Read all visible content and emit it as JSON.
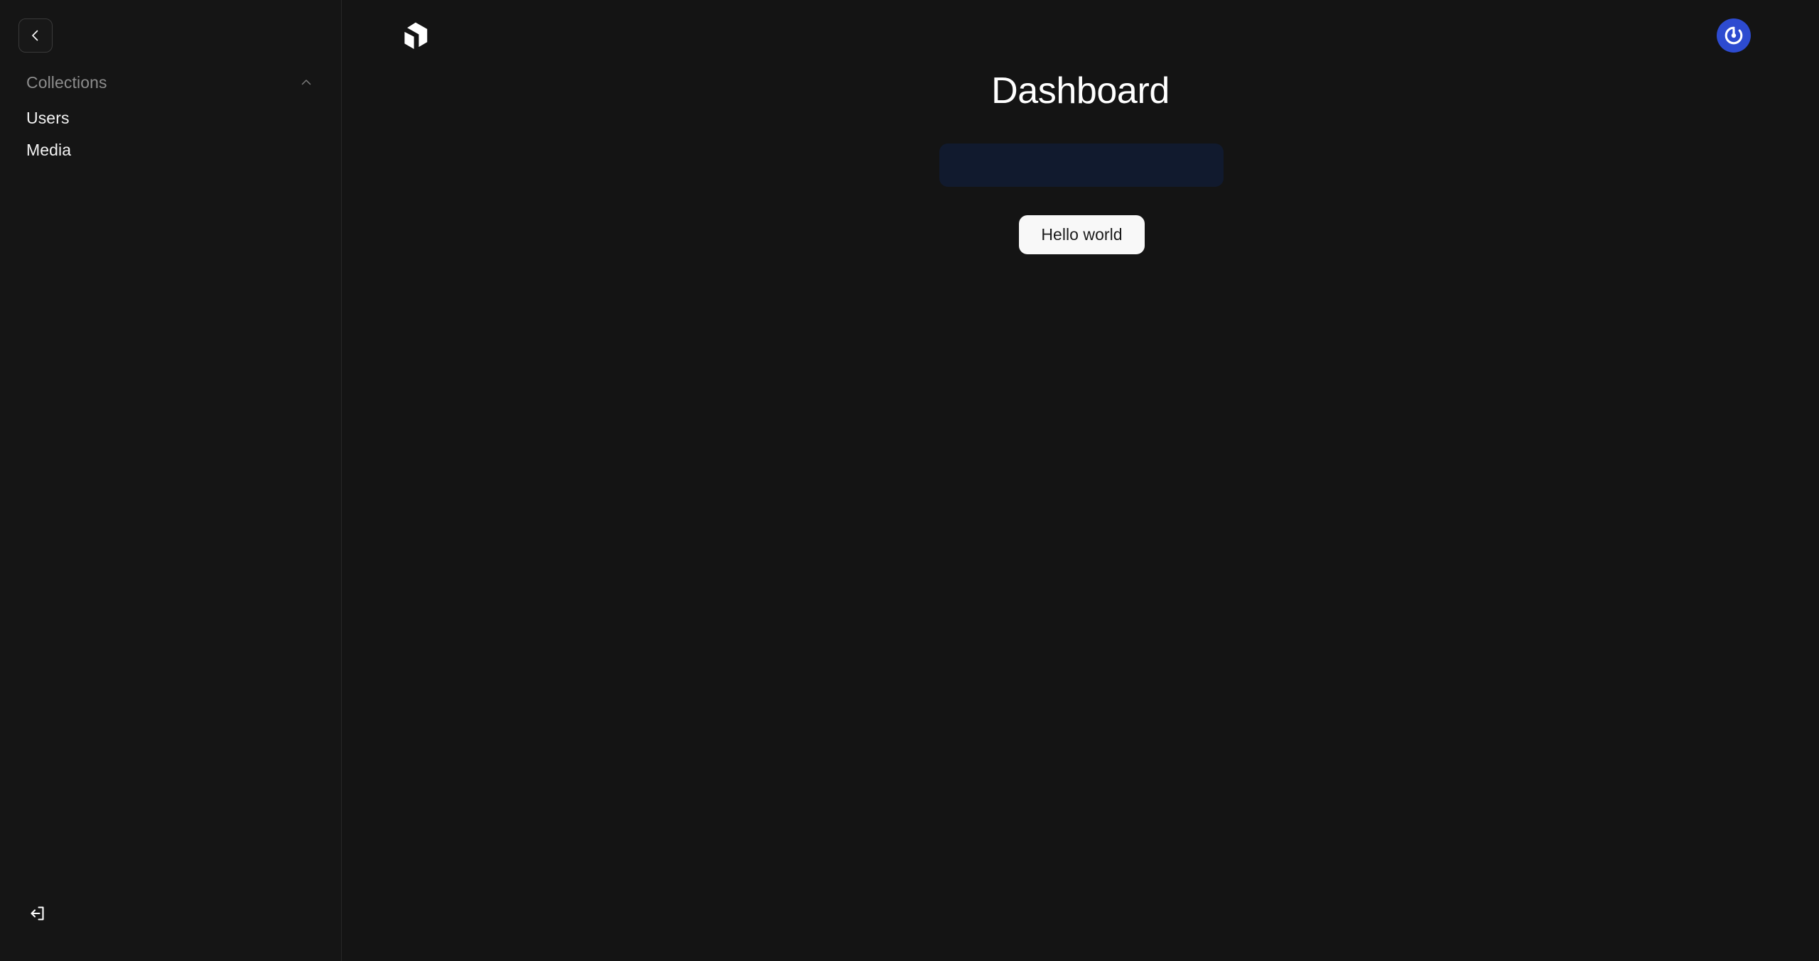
{
  "app": {
    "background_color": "#141414",
    "accent_color": "#2d4bd0"
  },
  "sidebar": {
    "collapse_button": {
      "label": "",
      "icon": "chevron-left-icon"
    },
    "groups": [
      {
        "title": "Collections",
        "toggle_icon": "chevron-up-icon",
        "expanded": true,
        "items": [
          {
            "label": "Users"
          },
          {
            "label": "Media"
          }
        ]
      }
    ],
    "logout": {
      "label": "",
      "icon": "logout-icon"
    }
  },
  "header": {
    "logo": {
      "name": "payload-logo-icon"
    },
    "account": {
      "name": "account-avatar",
      "icon": "gravatar-icon",
      "background_color": "#2d4bd0"
    }
  },
  "main": {
    "title": "Dashboard",
    "placeholder_panel": {
      "background_color": "#111a2e",
      "text": ""
    },
    "primary_button": {
      "label": "Hello world",
      "background_color": "#f8f8f8",
      "text_color": "#1a1a1a"
    }
  }
}
